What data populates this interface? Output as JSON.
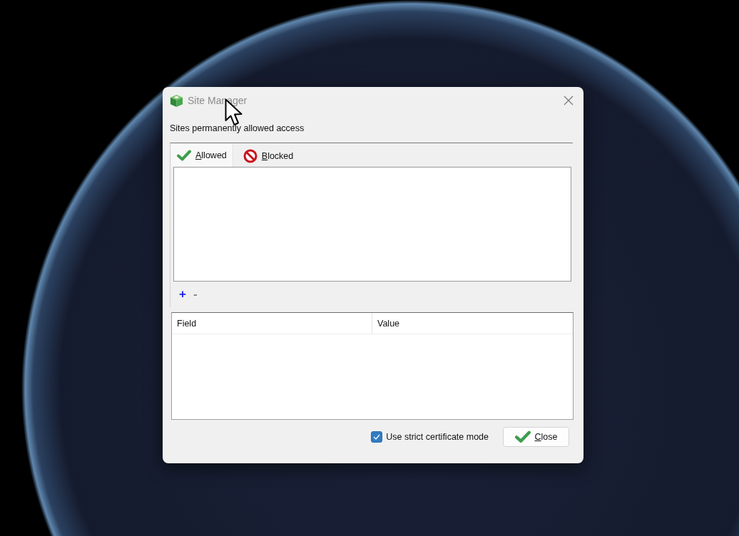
{
  "window": {
    "title": "Site Manager"
  },
  "caption": "Sites permanently allowed access",
  "tabs": [
    {
      "label": "Allowed",
      "kind": "allowed",
      "selected": true
    },
    {
      "label": "Blocked",
      "kind": "blocked",
      "selected": false
    }
  ],
  "toolbar": [
    {
      "label": "+",
      "disabled": false
    },
    {
      "label": "-",
      "disabled": true
    }
  ],
  "table": {
    "columns": [
      "Field",
      "Value"
    ]
  },
  "strict_mode": {
    "label": "Use strict certificate mode",
    "checked": true
  },
  "buttons": [
    {
      "label": "Close",
      "kind": "close"
    }
  ]
}
